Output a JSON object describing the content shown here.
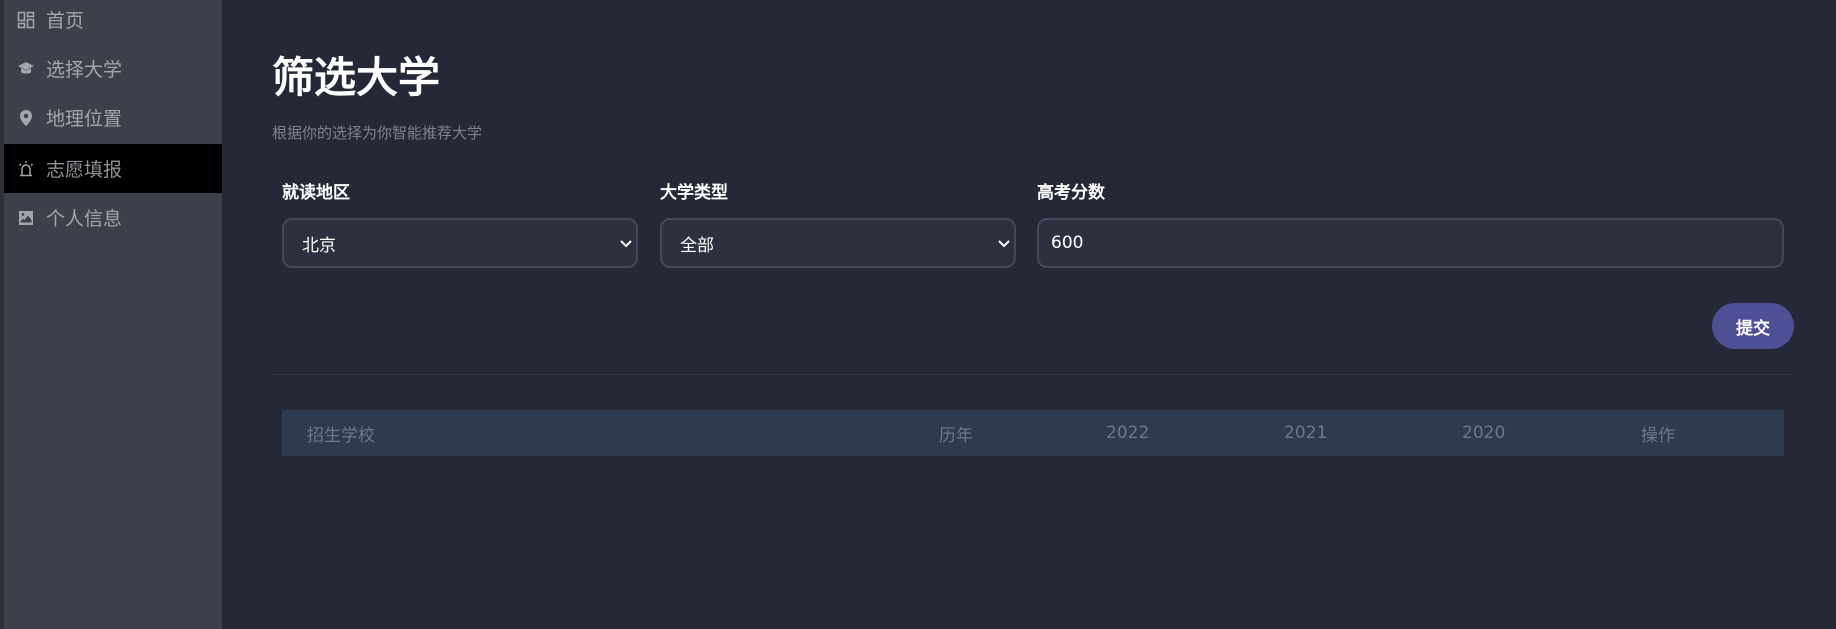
{
  "sidebar": {
    "items": [
      {
        "label": "首页",
        "icon": "dashboard-icon",
        "active": false
      },
      {
        "label": "选择大学",
        "icon": "graduation-cap-icon",
        "active": false
      },
      {
        "label": "地理位置",
        "icon": "map-pin-icon",
        "active": false
      },
      {
        "label": "志愿填报",
        "icon": "alarm-light-icon",
        "active": true
      },
      {
        "label": "个人信息",
        "icon": "image-icon",
        "active": false
      }
    ]
  },
  "main": {
    "title": "筛选大学",
    "subtitle": "根据你的选择为你智能推荐大学",
    "filters": {
      "region": {
        "label": "就读地区",
        "value": "北京"
      },
      "type": {
        "label": "大学类型",
        "value": "全部"
      },
      "score": {
        "label": "高考分数",
        "value": "600"
      }
    },
    "submit_label": "提交",
    "table": {
      "headers": [
        "招生学校",
        "历年",
        "2022",
        "2021",
        "2020",
        "操作"
      ]
    }
  },
  "colors": {
    "background": "#252837",
    "sidebar": "#3d3f4b",
    "active_item": "#000000",
    "accent_button": "#4e4f95",
    "table_header": "#2e3a4f"
  }
}
